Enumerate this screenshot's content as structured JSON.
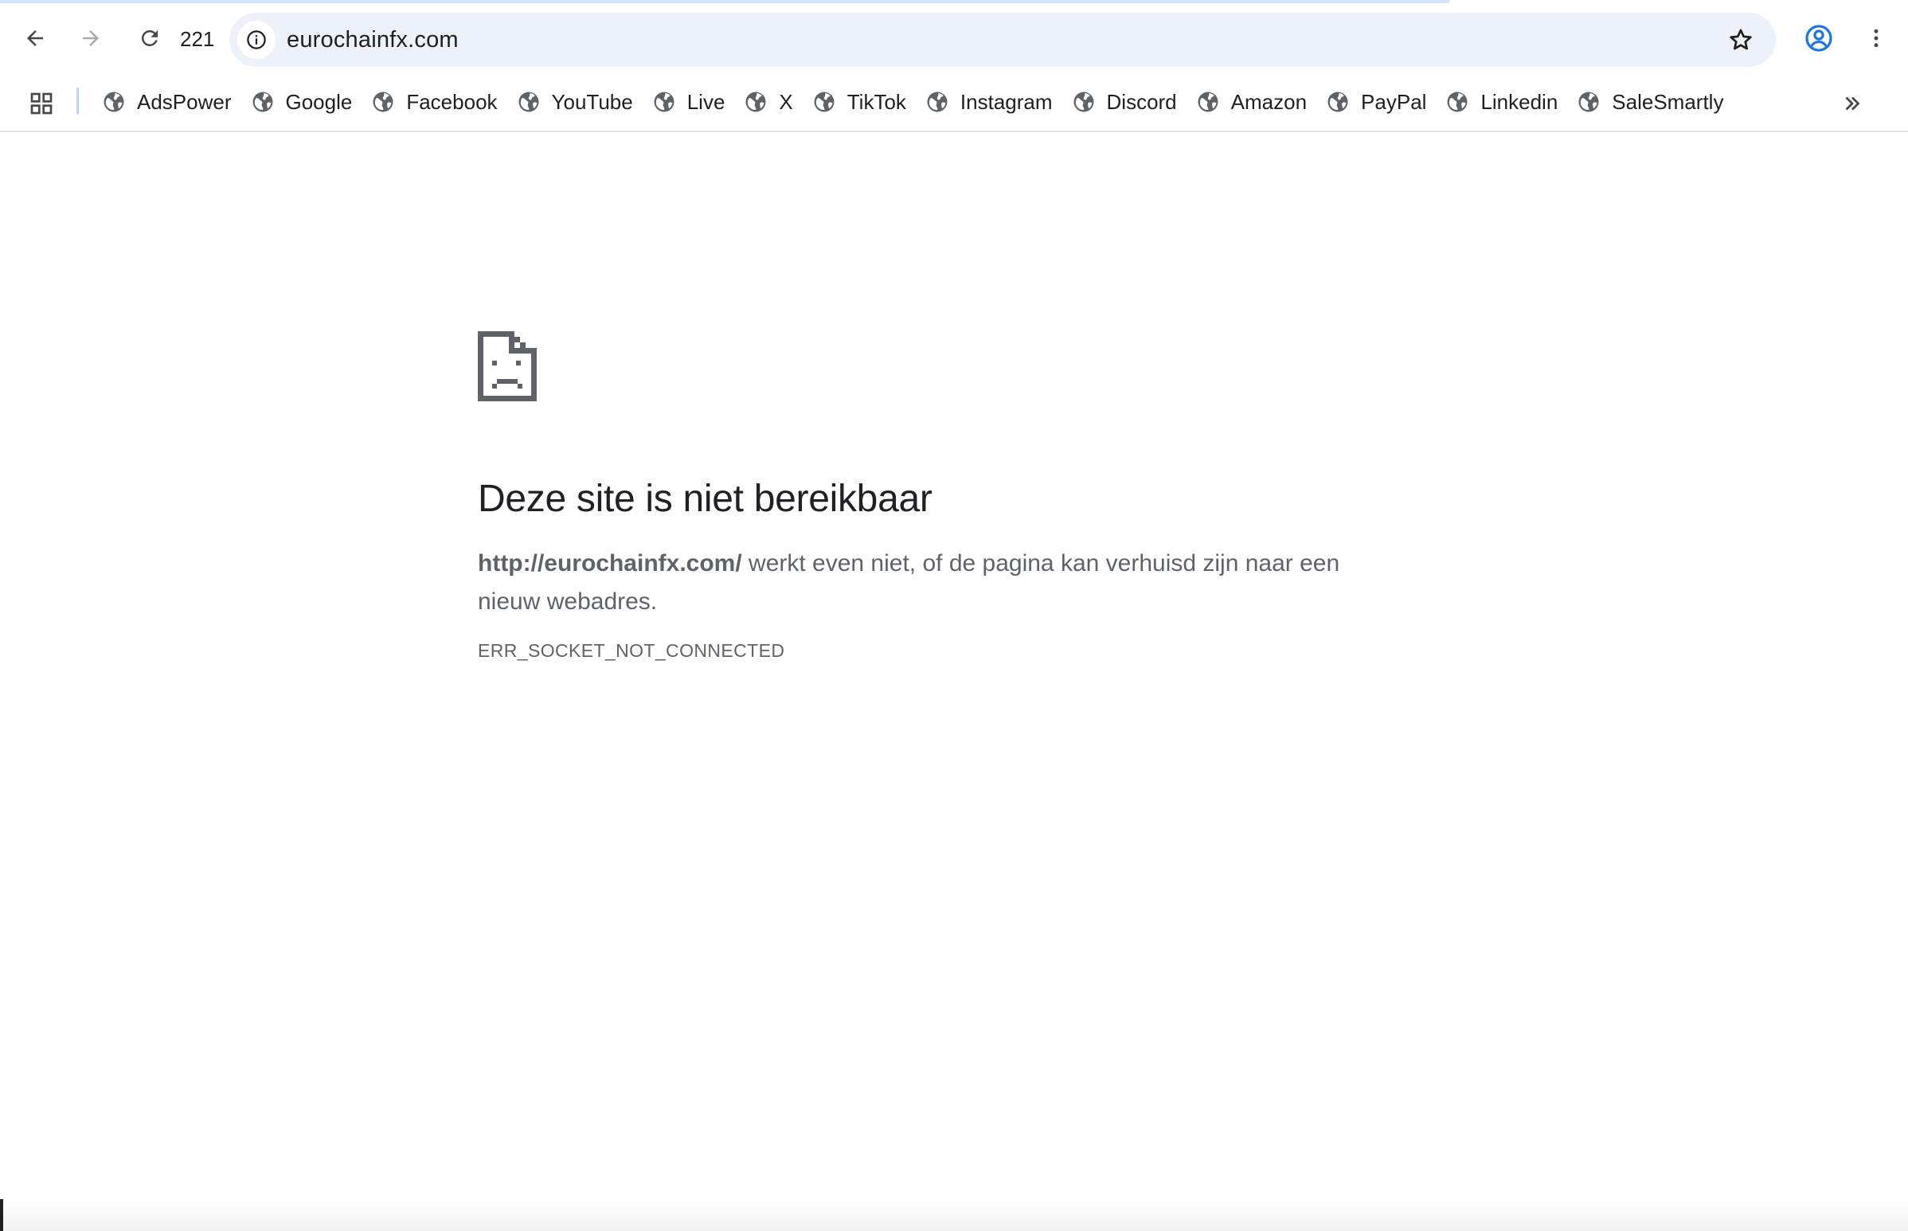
{
  "browser": {
    "loading_progress": 0.76,
    "reload_count": "221",
    "omnibox": {
      "url": "eurochainfx.com"
    },
    "icons": {
      "back": "arrow-left-icon",
      "forward": "arrow-right-icon",
      "reload": "reload-icon",
      "site_info": "info-icon",
      "bookmark": "star-icon",
      "profile": "account-circle-icon",
      "menu": "more-vert-icon",
      "apps": "apps-grid-icon",
      "more_bookmarks": "chevron-double-right-icon"
    },
    "colors": {
      "accent": "#1a73e8",
      "omnibox_bg": "#edf2fa",
      "progress": "#d3e3fd"
    }
  },
  "bookmarks": [
    {
      "label": "AdsPower"
    },
    {
      "label": "Google"
    },
    {
      "label": "Facebook"
    },
    {
      "label": "YouTube"
    },
    {
      "label": "Live"
    },
    {
      "label": "X"
    },
    {
      "label": "TikTok"
    },
    {
      "label": "Instagram"
    },
    {
      "label": "Discord"
    },
    {
      "label": "Amazon"
    },
    {
      "label": "PayPal"
    },
    {
      "label": "Linkedin"
    },
    {
      "label": "SaleSmartly"
    }
  ],
  "error": {
    "icon": "sad-document-icon",
    "title": "Deze site is niet bereikbaar",
    "url_bold": "http://eurochainfx.com/",
    "message": " werkt even niet, of de pagina kan verhuisd zijn naar een nieuw webadres.",
    "code": "ERR_SOCKET_NOT_CONNECTED"
  }
}
